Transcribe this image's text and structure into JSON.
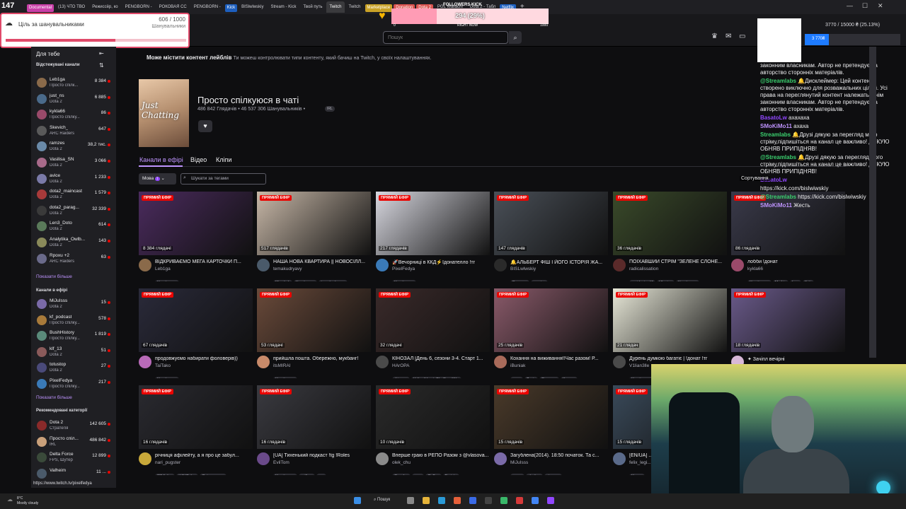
{
  "browser": {
    "tabs": [
      {
        "label": "Documental",
        "active": false,
        "color": "#c93fa8"
      },
      {
        "label": "(13) ЧТО ТВО",
        "active": false,
        "color": ""
      },
      {
        "label": "Режиссёр, ко",
        "active": false,
        "color": ""
      },
      {
        "label": "PENGBORN -",
        "active": false,
        "color": ""
      },
      {
        "label": "РОКОВАЯ СС",
        "active": false,
        "color": ""
      },
      {
        "label": "PENGBORN -",
        "active": false,
        "color": ""
      },
      {
        "label": "Kick",
        "active": false,
        "color": "#1d5fbf"
      },
      {
        "label": "BISlwlwskiy",
        "active": false,
        "color": ""
      },
      {
        "label": "Stream - Kick",
        "active": false,
        "color": ""
      },
      {
        "label": "Твой путь",
        "active": false,
        "color": ""
      },
      {
        "label": "Twitch",
        "active": true,
        "color": ""
      },
      {
        "label": "Twitch",
        "active": false,
        "color": ""
      },
      {
        "label": "Marketplace",
        "active": false,
        "color": "#c9a227"
      },
      {
        "label": "Donation",
        "active": false,
        "color": "#d9534f"
      },
      {
        "label": "Dota 2",
        "active": false,
        "color": "#d9534f"
      },
      {
        "label": "PGL Wallachi",
        "active": false,
        "color": ""
      },
      {
        "label": "Dota 2 - Табл",
        "active": false,
        "color": ""
      },
      {
        "label": "Netflix",
        "active": false,
        "color": "#1d5fbf"
      }
    ],
    "new_tab": "+",
    "min": "—",
    "max": "☐",
    "close": "✕"
  },
  "stream_overlay": {
    "viewers_count": "147",
    "goal_title": "Ціль за шанувальниками",
    "goal_count": "606 / 1000",
    "goal_unit": "Шанувальники",
    "goal_progress": 0.606,
    "followers_label": "FOLLOWERS KICK",
    "followers_progress_text": "294 (29%)",
    "followers_progress": 0.29,
    "followers_min": "0",
    "followers_mid": "RIGHT NOW",
    "followers_max": "1000"
  },
  "search": {
    "placeholder": "Пошук"
  },
  "sidebar": {
    "title": "Для тебе",
    "followed_header": "Відстежувані канали",
    "followed": [
      {
        "name": "Leb1ga",
        "game": "Просто спілк...",
        "viewers": "8 384",
        "color": "#8a6a4a"
      },
      {
        "name": "just_ns",
        "game": "Dota 2",
        "viewers": "6 885",
        "color": "#4a6a8a"
      },
      {
        "name": "kykla66",
        "game": "Просто спілку...",
        "viewers": "86",
        "color": "#9a4a6a"
      },
      {
        "name": "Skevich_",
        "game": "ARC Raiders",
        "viewers": "647",
        "color": "#5a5a5a"
      },
      {
        "name": "ramzes",
        "game": "Dota 2",
        "viewers": "38,2 тис.",
        "color": "#6a8aa8"
      },
      {
        "name": "Vasilisa_SN",
        "game": "Dota 2",
        "viewers": "3 066",
        "color": "#a86a8a"
      },
      {
        "name": "avice",
        "game": "Dota 2",
        "viewers": "1 233",
        "color": "#7a7aa8"
      },
      {
        "name": "dota2_maincast",
        "game": "Dota 2",
        "viewers": "1 579",
        "color": "#a83a3a"
      },
      {
        "name": "dota2_parag...",
        "game": "Dota 2",
        "viewers": "32 339",
        "color": "#3a3a3a"
      },
      {
        "name": "Len3_Doto",
        "game": "Dota 2",
        "viewers": "614",
        "color": "#5a7a5a"
      },
      {
        "name": "Analytika_Owlb...",
        "game": "Dota 2",
        "viewers": "143",
        "color": "#8a8a5a"
      },
      {
        "name": "Rpoxu +2",
        "game": "ARC Raiders",
        "viewers": "63",
        "color": "#6a6a8a"
      }
    ],
    "show_more_1": "Показати більше",
    "live_header": "Канали в ефірі",
    "live": [
      {
        "name": "MiJuIsss",
        "game": "Dota 2",
        "viewers": "15",
        "color": "#7a6aa8"
      },
      {
        "name": "kf_podcast",
        "game": "Просто спілку...",
        "viewers": "578",
        "color": "#a87a3a"
      },
      {
        "name": "BushHistory",
        "game": "Просто спілку...",
        "viewers": "1 819",
        "color": "#5a8a7a"
      },
      {
        "name": "klf_13",
        "game": "Dota 2",
        "viewers": "51",
        "color": "#8a5a5a"
      },
      {
        "name": "totustop",
        "game": "Dota 2",
        "viewers": "27",
        "color": "#4a4a7a"
      },
      {
        "name": "PixelFedya",
        "game": "Просто спілку...",
        "viewers": "217",
        "color": "#3a7ab8"
      }
    ],
    "show_more_2": "Показати більше",
    "rec_header": "Рекомендовані категорії",
    "categories": [
      {
        "name": "Dota 2",
        "game": "Стратегія",
        "viewers": "142 605",
        "color": "#8a2a2a"
      },
      {
        "name": "Просто спіл...",
        "game": "IRL",
        "viewers": "486 842",
        "color": "#c9a07a"
      },
      {
        "name": "Delta Force",
        "game": "FPS, Шутер",
        "viewers": "12 899",
        "color": "#3a4a3a"
      },
      {
        "name": "Valheim",
        "game": "",
        "viewers": "11 ...",
        "color": "#4a5a6a"
      }
    ]
  },
  "disclaimer": {
    "bold": "Може містити контент лейблів",
    "rest": "Ти можеш контролювати типи контенту, який бачиш на Twitch, у своїх налаштуваннях."
  },
  "category": {
    "art_text": "Just Chatting",
    "title": "Просто спілкуюся в чаті",
    "stats": "486 842 Глядачів • 46 537 306 Шанувальників •",
    "tag": "IRL",
    "heart": "♥"
  },
  "tabs": [
    "Канали в ефірі",
    "Відео",
    "Кліпи"
  ],
  "filters": {
    "lang_label": "Мова",
    "lang_count": "1",
    "tag_placeholder": "Шукати за тегами"
  },
  "live_label": "ПРЯМИЙ ЕФІР",
  "streams": [
    {
      "title": "ВІДКРИВАЄМО МЕГА КАРТОЧКИ П...",
      "channel": "Leb1ga",
      "viewers": "8 384 глядачі",
      "tags": [
        "Українська"
      ],
      "thumb": "#4b2b5e",
      "av": "#8a6a4a"
    },
    {
      "title": "НАША НОВА КВАРТИРА || НОВОСІЛЛ...",
      "channel": "temakudryavy",
      "viewers": "517 глядачів",
      "tags": [
        "MaryLvk",
        "Українська",
        "temakudryavy"
      ],
      "thumb": "#c8b8a8",
      "av": "#4a5a6a"
    },
    {
      "title": "🚀Вечорниці в ККД⚡Ідонателло !тг",
      "channel": "PixelFedya",
      "viewers": "217 глядачів",
      "tags": [
        "Українська"
      ],
      "thumb": "#d8d8e0",
      "av": "#3a7ab8"
    },
    {
      "title": "🔔АЛЬБЕРТ ФІШ І ЙОГО ІСТОРІЯ ЖА...",
      "channel": "BISLwlwskiy",
      "viewers": "147 глядачів",
      "tags": [
        "Ветеран",
        "gaming"
      ],
      "thumb": "#4a5058",
      "av": "#2a2a2a"
    },
    {
      "title": "ПОЇХАВШИЙ СТРІМ \"ЗЕЛЕНЕ СЛОНЕ...",
      "channel": "radicalissation",
      "viewers": "36 глядачів",
      "tags": [
        "residentevil4",
        "Ukraine",
        "Українська"
      ],
      "thumb": "#3a4a2a",
      "av": "#5a2a2a"
    },
    {
      "title": "лобби !донат",
      "channel": "kykla66",
      "viewers": "86 глядачів",
      "tags": [
        "Українська",
        "Мафія",
        "Ігри",
        "Київ"
      ],
      "thumb": "#3a3a4a",
      "av": "#9a4a6a"
    },
    {
      "title": "продовжуємо набирати фоловерів))",
      "channel": "TaiTako",
      "viewers": "67 глядачів",
      "tags": [
        "Українська"
      ],
      "thumb": "#2a2a3a",
      "av": "#b86ab8"
    },
    {
      "title": "прийшла пошта. Обережно, мукбанг!",
      "channel": "itsMIRAI",
      "viewers": "53 глядачі",
      "tags": [
        "Українська"
      ],
      "thumb": "#6a4a3a",
      "av": "#c88a6a"
    },
    {
      "title": "КІНОЗАЛ [День 6, сезони 3-4. Старт 1...",
      "channel": "HArOPA",
      "viewers": "32 глядачі",
      "tags": [
        "фільми",
        "ValiantHeartsTheGreatWar"
      ],
      "thumb": "#3a2a2a",
      "av": "#4a4a4a"
    },
    {
      "title": "Кохання на виживання!!Час разом! P...",
      "channel": "iBuniak",
      "viewers": "25 глядачів",
      "tags": [
        "таро",
        "Львів",
        "Розмови",
        "Краков"
      ],
      "thumb": "#8a5a6a",
      "av": "#a86a5a"
    },
    {
      "title": "Дурень думкою багатіє | !донат !тг",
      "channel": "V1lian3lle",
      "viewers": "21 глядач",
      "tags": [
        "Українська"
      ],
      "thumb": "#e8e8d8",
      "av": "#4a4a4a"
    },
    {
      "title": "✦ Зачіпл вечірні",
      "channel": "",
      "viewers": "18 глядачів",
      "tags": [],
      "thumb": "#6a5a8a",
      "av": "#d8b8d8"
    },
    {
      "title": "річниця афілейту, а я про це забул...",
      "channel": "nari_pugster",
      "viewers": "16 глядачів",
      "tags": [
        "20Vtuber",
        "UAVTuber",
        "Спілкування"
      ],
      "thumb": "#2a2a30",
      "av": "#c8a83a"
    },
    {
      "title": "[UA] Тихенький подкаст !tg !Roles",
      "channel": "EvilTom",
      "viewers": "16 глядачів",
      "tags": [
        "Українська",
        "eviltom",
        "rpg"
      ],
      "thumb": "#3a3a40",
      "av": "#6a4a8a"
    },
    {
      "title": "Вперше граю в РЕПО Разом з @vlasova...",
      "channel": "olek_chu",
      "viewers": "10 глядачів",
      "tags": [
        "Cosplay",
        "кава",
        "Coffee",
        "Barista"
      ],
      "thumb": "#2a2a2a",
      "av": "#8a8a8a"
    },
    {
      "title": "Загублена(2014). 18:50 початок. Та с...",
      "channel": "MiJuIsss",
      "viewers": "15 глядачів",
      "tags": [
        "game",
        "chating",
        "дівчина"
      ],
      "thumb": "#4a3a2a",
      "av": "#7a6aa8"
    },
    {
      "title": "[EN/UA] ...",
      "channel": "felix_legi...",
      "viewers": "15 глядачів",
      "tags": [
        "Укра..."
      ],
      "thumb": "#3a4a5a",
      "av": "#5a6a8a"
    }
  ],
  "chat": {
    "lines": [
      {
        "user": "",
        "text": "законним власникам. Автор не претендує на авторство сторонніх матеріалів.",
        "color": "#efeff1"
      },
      {
        "user": "@Streamlabs",
        "text": "🔔Дисклеймер: Цей контент створено виключно для розважальних цілей. Усі права на переглянутий контент належать їхнім законним власникам. Автор не претендує на авторство сторонніх матеріалів.",
        "color": "#3bd16f"
      },
      {
        "user": "BasatoLw",
        "text": "ахахаха",
        "color": "#9147ff"
      },
      {
        "user": "SMoKiMo11",
        "text": "ахаха",
        "color": "#bf94ff"
      },
      {
        "user": "Streamlabs",
        "text": "🔔Друзі дякую за перегляд мого стріму,підпишіться на канал це важливо! ДЯКУЮ ОБНЯВ ПРИПІДНЯВ!",
        "color": "#3bd16f"
      },
      {
        "user": "@Streamlabs",
        "text": "🔔Друзі дякую за перегляд мого стріму,підпишіться на канал це важливо! ДЯКУЮ ОБНЯВ ПРИПІДНЯВ!",
        "color": "#3bd16f"
      },
      {
        "user": "BasatoLw",
        "text": "",
        "color": "#9147ff"
      },
      {
        "user": "",
        "text": "https://kick.com/bislwiwskiy",
        "color": "#efeff1"
      },
      {
        "user": "@Streamlabs",
        "text": "https://kick.com/bislwiwskiy",
        "color": "#3bd16f"
      },
      {
        "user": "SMoKiMo11",
        "text": "Жесть",
        "color": "#bf94ff"
      }
    ],
    "donation": "3770 / 15000 ₴ (25.13%)",
    "donation_bar": "3 770₴",
    "donation_progress": 0.2513
  },
  "sort_label": "Сортування",
  "status_url": "https://www.twitch.tv/pixelfedya",
  "taskbar": {
    "weather_temp": "8°C",
    "weather_desc": "Mostly cloudy",
    "search": "Пошук"
  }
}
